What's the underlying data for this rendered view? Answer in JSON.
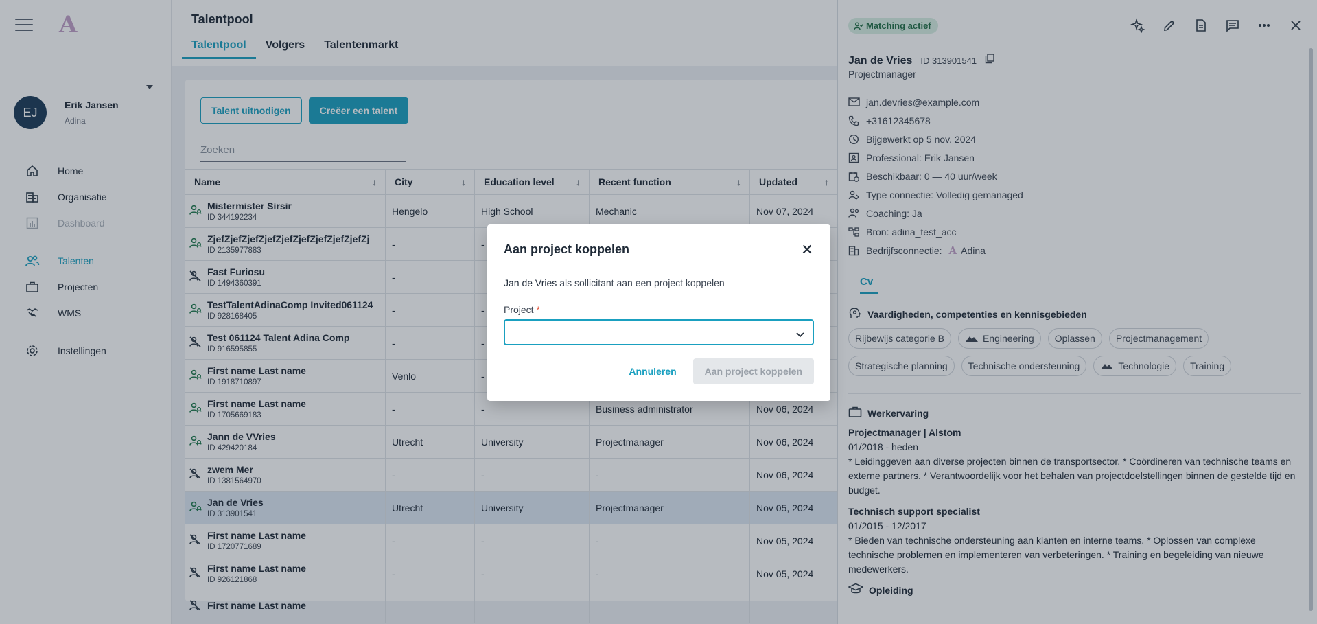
{
  "sidebar": {
    "logo": "A",
    "user": {
      "initials": "EJ",
      "name": "Erik Jansen",
      "org": "Adina"
    },
    "nav": [
      {
        "label": "Home",
        "icon": "home-icon"
      },
      {
        "label": "Organisatie",
        "icon": "building-icon"
      },
      {
        "label": "Dashboard",
        "icon": "chart-icon",
        "disabled": true
      },
      {
        "label": "Talenten",
        "icon": "people-icon",
        "active": true
      },
      {
        "label": "Projecten",
        "icon": "briefcase-icon"
      },
      {
        "label": "WMS",
        "icon": "handshake-icon"
      },
      {
        "label": "Instellingen",
        "icon": "gear-icon"
      }
    ]
  },
  "main": {
    "title": "Talentpool",
    "tabs": [
      "Talentpool",
      "Volgers",
      "Talentenmarkt"
    ],
    "active_tab": "Talentpool",
    "invite_label": "Talent uitnodigen",
    "create_label": "Creëer een talent",
    "search_placeholder": "Zoeken",
    "columns": [
      "Name",
      "City",
      "Education level",
      "Recent function",
      "Updated"
    ],
    "rows": [
      {
        "name": "Mistermister Sirsir",
        "id": "ID 344192234",
        "city": "Hengelo",
        "edu": "High School",
        "func": "Mechanic",
        "updated": "Nov 07, 2024",
        "matching": true
      },
      {
        "name": "ZjefZjefZjefZjefZjefZjefZjefZjefZjefZj",
        "id": "ID 2135977883",
        "city": "-",
        "edu": "-",
        "func": "",
        "updated": "",
        "matching": true
      },
      {
        "name": "Fast Furiosu",
        "id": "ID 1494360391",
        "city": "-",
        "edu": "",
        "func": "",
        "updated": "",
        "matching": false
      },
      {
        "name": "TestTalentAdinaComp Invited061124",
        "id": "ID 928168405",
        "city": "-",
        "edu": "-",
        "func": "",
        "updated": "",
        "matching": true
      },
      {
        "name": "Test 061124 Talent Adina Comp",
        "id": "ID 916595855",
        "city": "-",
        "edu": "-",
        "func": "",
        "updated": "",
        "matching": false
      },
      {
        "name": "First name Last name",
        "id": "ID 1918710897",
        "city": "Venlo",
        "edu": "-",
        "func": "",
        "updated": "",
        "matching": true
      },
      {
        "name": "First name Last name",
        "id": "ID 1705669183",
        "city": "-",
        "edu": "-",
        "func": "Business administrator",
        "updated": "Nov 06, 2024",
        "matching": true
      },
      {
        "name": "Jann de VVries",
        "id": "ID 429420184",
        "city": "Utrecht",
        "edu": "University",
        "func": "Projectmanager",
        "updated": "Nov 06, 2024",
        "matching": true
      },
      {
        "name": "zwem Mer",
        "id": "ID 1381564970",
        "city": "-",
        "edu": "-",
        "func": "-",
        "updated": "Nov 06, 2024",
        "matching": false
      },
      {
        "name": "Jan de Vries",
        "id": "ID 313901541",
        "city": "Utrecht",
        "edu": "University",
        "func": "Projectmanager",
        "updated": "Nov 05, 2024",
        "matching": true,
        "selected": true
      },
      {
        "name": "First name Last name",
        "id": "ID 1720771689",
        "city": "-",
        "edu": "-",
        "func": "-",
        "updated": "Nov 05, 2024",
        "matching": false
      },
      {
        "name": "First name Last name",
        "id": "ID 926121868",
        "city": "-",
        "edu": "-",
        "func": "-",
        "updated": "Nov 05, 2024",
        "matching": false
      },
      {
        "name": "First name Last name",
        "id": "",
        "city": "",
        "edu": "",
        "func": "",
        "updated": "",
        "matching": false
      }
    ]
  },
  "panel": {
    "badge": "Matching actief",
    "name": "Jan de Vries",
    "id": "ID 313901541",
    "function": "Projectmanager",
    "info": [
      {
        "icon": "mail-icon",
        "text": "jan.devries@example.com"
      },
      {
        "icon": "phone-icon",
        "text": "+31612345678"
      },
      {
        "icon": "history-icon",
        "text": "Bijgewerkt op 5 nov. 2024"
      },
      {
        "icon": "contact-card-icon",
        "text": "Professional: Erik Jansen"
      },
      {
        "icon": "calendar-clock-icon",
        "text": "Beschikbaar: 0 — 40 uur/week"
      },
      {
        "icon": "person-link-icon",
        "text": "Type connectie: Volledig gemanaged"
      },
      {
        "icon": "coaching-icon",
        "text": "Coaching: Ja"
      },
      {
        "icon": "source-icon",
        "text": "Bron: adina_test_acc"
      },
      {
        "icon": "company-icon",
        "text": "Bedrijfsconnectie:",
        "extra": "Adina"
      }
    ],
    "cv_tab": "Cv",
    "skills_title": "Vaardigheden, competenties en kennisgebieden",
    "skills": [
      {
        "label": "Rijbewijs categorie B",
        "icon": false
      },
      {
        "label": "Engineering",
        "icon": true
      },
      {
        "label": "Oplassen",
        "icon": false
      },
      {
        "label": "Projectmanagement",
        "icon": false
      },
      {
        "label": "Strategische planning",
        "icon": false
      },
      {
        "label": "Technische ondersteuning",
        "icon": false
      },
      {
        "label": "Technologie",
        "icon": true
      },
      {
        "label": "Training",
        "icon": false
      }
    ],
    "work_title": "Werkervaring",
    "work": [
      {
        "title": "Projectmanager | Alstom",
        "period": "01/2018 - heden",
        "desc": "* Leidinggeven aan diverse projecten binnen de transportsector. * Coördineren van technische teams en externe partners. * Verantwoordelijk voor het behalen van projectdoelstellingen binnen de gestelde tijd en budget."
      },
      {
        "title": "Technisch support specialist",
        "period": "01/2015 - 12/2017",
        "desc": "* Bieden van technische ondersteuning aan klanten en interne teams. * Oplossen van complexe technische problemen en implementeren van verbeteringen. * Training en begeleiding van nieuwe medewerkers."
      }
    ],
    "education_title": "Opleiding"
  },
  "dialog": {
    "title": "Aan project koppelen",
    "text_name": "Jan de Vries",
    "text_rest": " als sollicitant aan een project koppelen",
    "field_label": "Project",
    "required_mark": "*",
    "cancel_label": "Annuleren",
    "confirm_label": "Aan project koppelen"
  }
}
